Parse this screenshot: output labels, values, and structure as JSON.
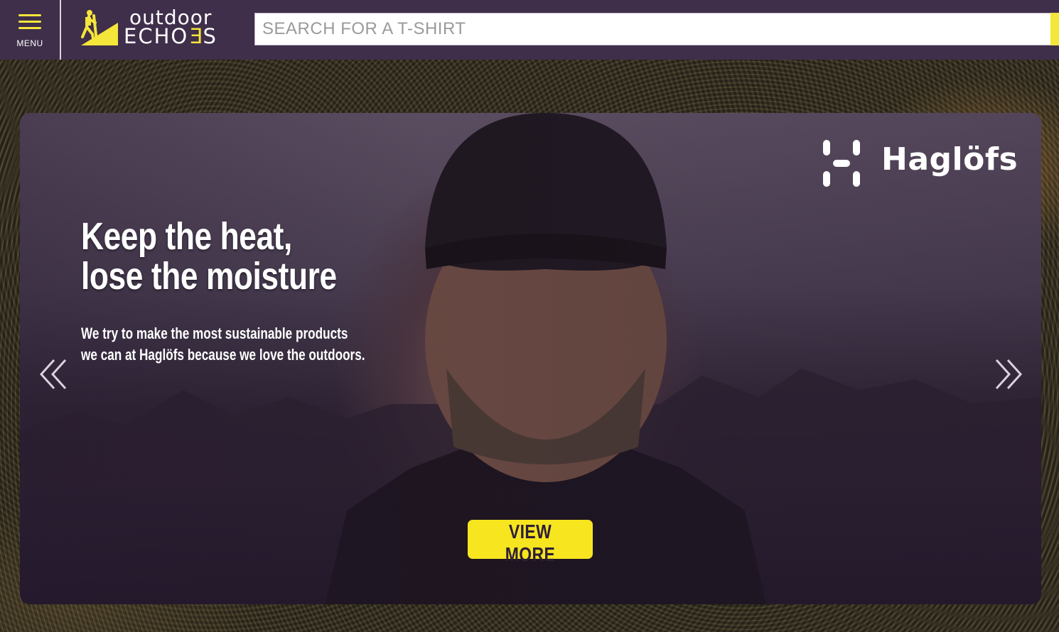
{
  "header": {
    "menu_label": "MENU",
    "logo": {
      "word1": "outdoor",
      "word2_pre": "ECHO",
      "word2_accent": "E",
      "word2_post": "S"
    },
    "search": {
      "placeholder": "SEARCH FOR A T-SHIRT",
      "value": ""
    }
  },
  "hero": {
    "title_line1": "Keep the heat,",
    "title_line2": "lose the moisture",
    "subtitle_line1": "We try to make the most sustainable products",
    "subtitle_line2": "we can at Haglöfs because we love the outdoors.",
    "brand_name": "Haglöfs",
    "cta_label": "VIEW MORE",
    "prev_icon": "double-chevron-left-icon",
    "next_icon": "double-chevron-right-icon"
  },
  "colors": {
    "header_bg": "#3f2f4b",
    "accent": "#f5e63a",
    "cta_bg": "#f7e51f",
    "cta_text": "#2d1f35"
  }
}
